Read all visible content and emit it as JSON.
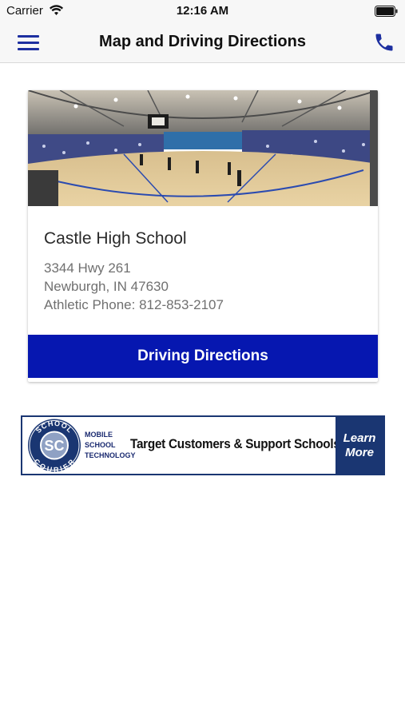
{
  "status_bar": {
    "carrier": "Carrier",
    "time": "12:16 AM"
  },
  "nav": {
    "title": "Map and Driving Directions"
  },
  "school": {
    "name": "Castle High School",
    "address_line1": "3344 Hwy 261",
    "address_line2": "Newburgh, IN 47630",
    "athletic_phone": "Athletic Phone: 812-853-2107",
    "directions_label": "Driving Directions"
  },
  "ad": {
    "logo_top": "SCHOOL",
    "logo_initials": "SC",
    "logo_bottom": "COURIER",
    "tech_line1": "MOBILE",
    "tech_line2": "SCHOOL",
    "tech_line3": "TECHNOLOGY",
    "headline": "Target Customers & Support Schools",
    "cta_line1": "Learn",
    "cta_line2": "More"
  },
  "colors": {
    "accent_blue": "#0617b0",
    "nav_icon_blue": "#1d2fa0",
    "ad_navy": "#1a3672"
  },
  "icons": [
    "wifi-icon",
    "battery-icon",
    "hamburger-menu-icon",
    "phone-icon"
  ]
}
